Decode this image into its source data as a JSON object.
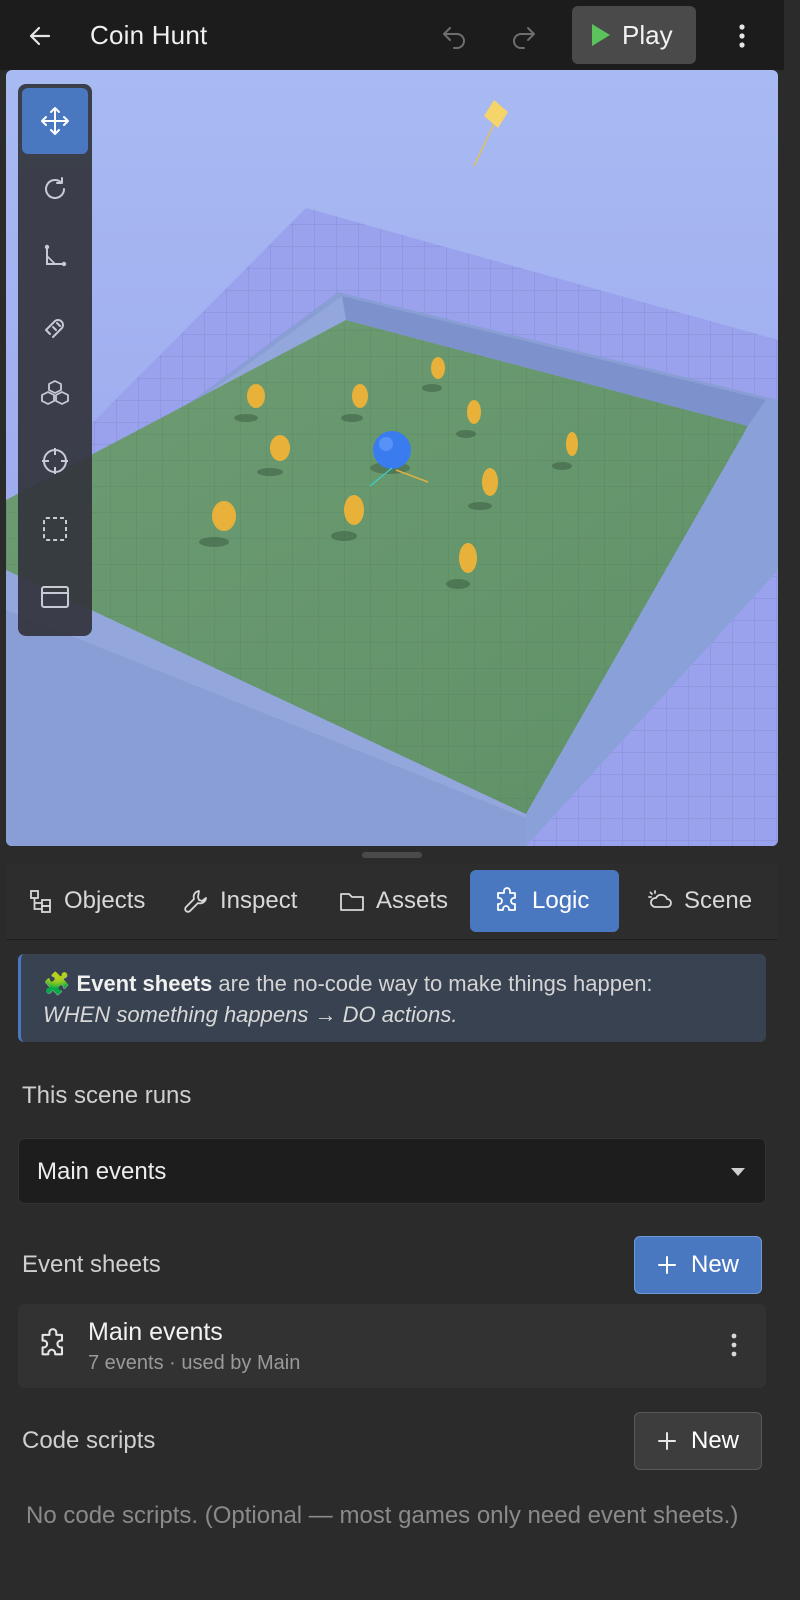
{
  "header": {
    "title": "Coin Hunt",
    "play_label": "Play"
  },
  "colors": {
    "accent": "#4a78c0",
    "play_icon": "#5cc35c",
    "sky": "#a4b0f0",
    "floor": "#6a9a6e",
    "coin": "#e8b23a",
    "player": "#3a7cf0"
  },
  "viewport_tools": [
    {
      "icon": "move-icon",
      "active": true
    },
    {
      "icon": "rotate-icon",
      "active": false
    },
    {
      "icon": "scale-icon",
      "active": false
    },
    {
      "icon": "magnet-icon",
      "active": false
    },
    {
      "icon": "cubes-icon",
      "active": false
    },
    {
      "icon": "crosshair-icon",
      "active": false
    },
    {
      "icon": "select-box-icon",
      "active": false
    },
    {
      "icon": "window-icon",
      "active": false
    }
  ],
  "tabs": [
    {
      "label": "Objects",
      "icon": "hierarchy-icon",
      "active": false
    },
    {
      "label": "Inspect",
      "icon": "wrench-icon",
      "active": false
    },
    {
      "label": "Assets",
      "icon": "folder-icon",
      "active": false
    },
    {
      "label": "Logic",
      "icon": "puzzle-icon",
      "active": true
    },
    {
      "label": "Scene",
      "icon": "weather-icon",
      "active": false
    }
  ],
  "logic": {
    "info_bold": "Event sheets",
    "info_text": " are the no-code way to make things happen:",
    "info_italic": "WHEN something happens → DO actions.",
    "scene_runs_label": "This scene runs",
    "scene_runs_value": "Main events",
    "event_sheets_label": "Event sheets",
    "new_label": "New",
    "sheets": [
      {
        "name": "Main events",
        "meta": "7 events · used by Main"
      }
    ],
    "code_scripts_label": "Code scripts",
    "code_new_label": "New",
    "code_empty_text": "No code scripts. (Optional — most games only need event sheets.)"
  }
}
